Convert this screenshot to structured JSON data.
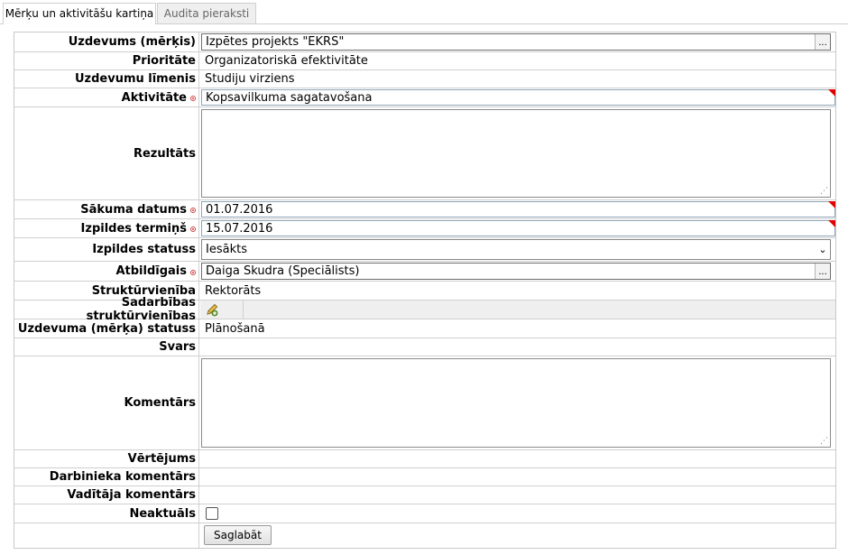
{
  "tabs": [
    {
      "label": "Mērķu un aktivitāšu kartiņa",
      "active": true
    },
    {
      "label": "Audita pieraksti",
      "active": false
    }
  ],
  "form": {
    "task_goal": {
      "label": "Uzdevums (mērķis)",
      "value": "Izpētes projekts \"EKRS\"",
      "lookup": "..."
    },
    "priority": {
      "label": "Prioritāte",
      "value": "Organizatoriskā efektivitāte"
    },
    "task_level": {
      "label": "Uzdevumu līmenis",
      "value": "Studiju virziens"
    },
    "activity": {
      "label": "Aktivitāte",
      "value": "Kopsavilkuma sagatavošana"
    },
    "result": {
      "label": "Rezultāts",
      "value": ""
    },
    "start_date": {
      "label": "Sākuma datums",
      "value": "01.07.2016"
    },
    "deadline": {
      "label": "Izpildes termiņš",
      "value": "15.07.2016"
    },
    "exec_status": {
      "label": "Izpildes statuss",
      "value": "Iesākts"
    },
    "responsible": {
      "label": "Atbildīgais",
      "value": "Daiga Skudra (Speciālists)",
      "lookup": "..."
    },
    "unit": {
      "label": "Struktūrvienība",
      "value": "Rektorāts"
    },
    "coop_units": {
      "label": "Sadarbības struktūrvienības",
      "icon": "pencil-icon"
    },
    "task_status": {
      "label": "Uzdevuma (mērķa) statuss",
      "value": "Plānošanā"
    },
    "weight": {
      "label": "Svars",
      "value": ""
    },
    "comments": {
      "label": "Komentārs",
      "value": ""
    },
    "rating": {
      "label": "Vērtējums",
      "value": ""
    },
    "employee_comment": {
      "label": "Darbinieka komentārs",
      "value": ""
    },
    "manager_comment": {
      "label": "Vadītāja komentārs",
      "value": ""
    },
    "outdated": {
      "label": "Neaktuāls",
      "checked": false
    },
    "save_label": "Saglabāt"
  },
  "colors": {
    "required_marker": "#d04040",
    "required_corner": "#e00000",
    "border": "#cfcfcf"
  }
}
